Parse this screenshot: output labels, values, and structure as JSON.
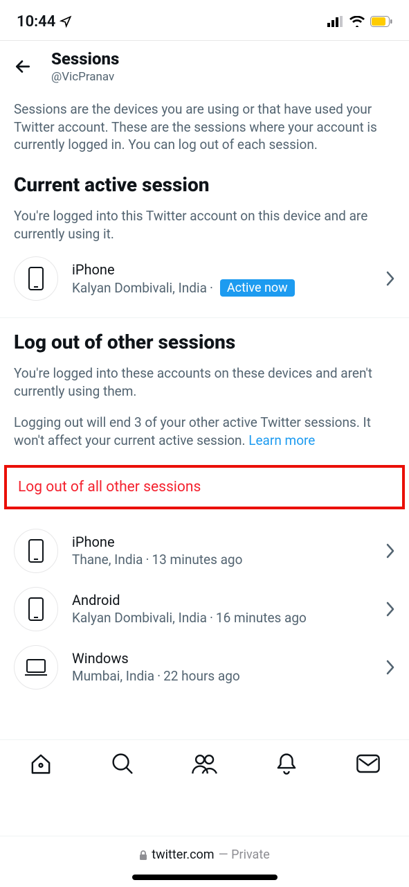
{
  "statusBar": {
    "time": "10:44"
  },
  "header": {
    "title": "Sessions",
    "subtitle": "@VicPranav"
  },
  "introText": "Sessions are the devices you are using or that have used your Twitter account. These are the sessions where your account is currently logged in. You can log out of each session.",
  "currentSection": {
    "heading": "Current active session",
    "desc": "You're logged into this Twitter account on this device and are currently using it.",
    "session": {
      "device": "iPhone",
      "location": "Kalyan Dombivali, India",
      "badge": "Active now"
    }
  },
  "otherSection": {
    "heading": "Log out of other sessions",
    "desc1": "You're logged into these accounts on these devices and aren't currently using them.",
    "desc2": "Logging out will end 3 of your other active Twitter sessions. It won't affect your current active session. ",
    "learnMore": "Learn more",
    "logoutAll": "Log out of all other sessions",
    "sessions": [
      {
        "device": "iPhone",
        "location": "Thane, India",
        "time": "13 minutes ago",
        "deviceType": "phone"
      },
      {
        "device": "Android",
        "location": "Kalyan Dombivali, India",
        "time": "16 minutes ago",
        "deviceType": "phone"
      },
      {
        "device": "Windows",
        "location": "Mumbai, India",
        "time": "22 hours ago",
        "deviceType": "laptop"
      }
    ]
  },
  "browser": {
    "domain": "twitter.com",
    "private": " — Private"
  }
}
